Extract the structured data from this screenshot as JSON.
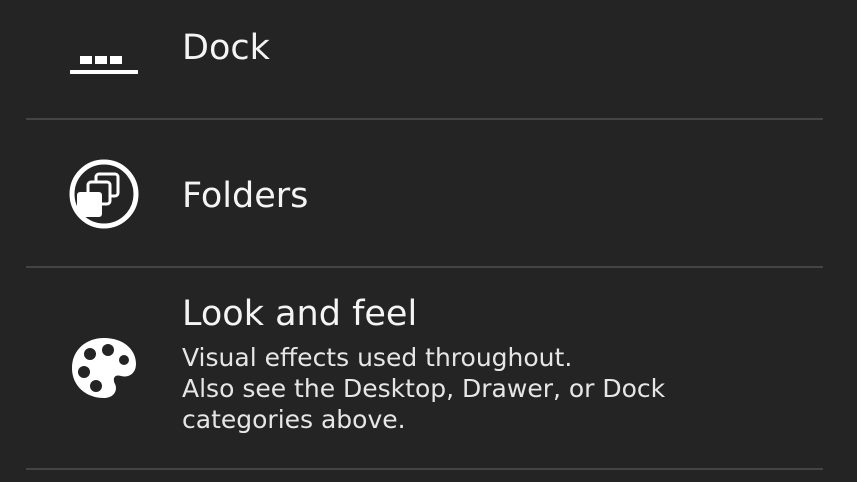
{
  "settings": {
    "items": [
      {
        "title": "Dock",
        "icon": "dock-icon"
      },
      {
        "title": "Folders",
        "icon": "folders-icon"
      },
      {
        "title": "Look and feel",
        "icon": "palette-icon",
        "summary_lines": [
          "Visual effects used throughout.",
          "Also see the Desktop, Drawer, or Dock",
          "categories above."
        ]
      }
    ]
  },
  "colors": {
    "background": "#242424",
    "divider": "#444444",
    "text": "#f4f4f4"
  }
}
